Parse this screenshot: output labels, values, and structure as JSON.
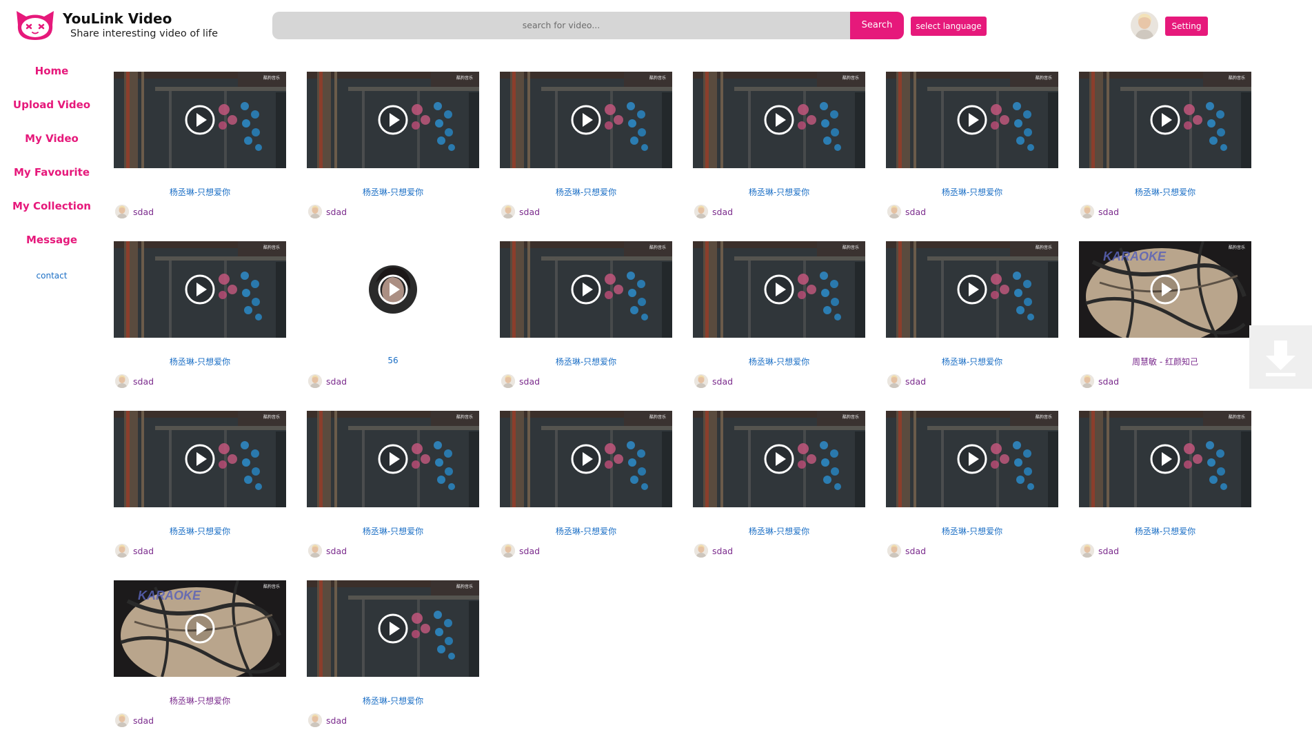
{
  "header": {
    "brand_title": "YouLink Video",
    "brand_subtitle": "Share interesting video of life",
    "search_placeholder": "search for video...",
    "search_label": "Search",
    "language_label": "select language",
    "setting_label": "Setting"
  },
  "sidebar": {
    "items": [
      {
        "label": "Home"
      },
      {
        "label": "Upload Video"
      },
      {
        "label": "My Video"
      },
      {
        "label": "My Favourite"
      },
      {
        "label": "My Collection"
      },
      {
        "label": "Message"
      }
    ],
    "contact": "contact"
  },
  "badge_text": "酷狗音乐",
  "colors": {
    "accent": "#e6197b",
    "link": "#1a6ec5",
    "visited": "#7a2a8c"
  },
  "videos": [
    {
      "title": "杨丞琳-只想爱你",
      "author": "sdad",
      "thumb": "room",
      "visited": false
    },
    {
      "title": "杨丞琳-只想爱你",
      "author": "sdad",
      "thumb": "room",
      "visited": false
    },
    {
      "title": "杨丞琳-只想爱你",
      "author": "sdad",
      "thumb": "room",
      "visited": false
    },
    {
      "title": "杨丞琳-只想爱你",
      "author": "sdad",
      "thumb": "room",
      "visited": false
    },
    {
      "title": "杨丞琳-只想爱你",
      "author": "sdad",
      "thumb": "room",
      "visited": false
    },
    {
      "title": "杨丞琳-只想爱你",
      "author": "sdad",
      "thumb": "room",
      "visited": false
    },
    {
      "title": "杨丞琳-只想爱你",
      "author": "sdad",
      "thumb": "room",
      "visited": false
    },
    {
      "title": "56",
      "author": "sdad",
      "thumb": "portrait",
      "visited": false
    },
    {
      "title": "杨丞琳-只想爱你",
      "author": "sdad",
      "thumb": "room",
      "visited": false
    },
    {
      "title": "杨丞琳-只想爱你",
      "author": "sdad",
      "thumb": "room",
      "visited": false
    },
    {
      "title": "杨丞琳-只想爱你",
      "author": "sdad",
      "thumb": "room",
      "visited": false
    },
    {
      "title": "周慧敏 - 红颜知己",
      "author": "sdad",
      "thumb": "karaoke",
      "visited": true
    },
    {
      "title": "杨丞琳-只想爱你",
      "author": "sdad",
      "thumb": "room",
      "visited": false
    },
    {
      "title": "杨丞琳-只想爱你",
      "author": "sdad",
      "thumb": "room",
      "visited": false
    },
    {
      "title": "杨丞琳-只想爱你",
      "author": "sdad",
      "thumb": "room",
      "visited": false
    },
    {
      "title": "杨丞琳-只想爱你",
      "author": "sdad",
      "thumb": "room",
      "visited": false
    },
    {
      "title": "杨丞琳-只想爱你",
      "author": "sdad",
      "thumb": "room",
      "visited": false
    },
    {
      "title": "杨丞琳-只想爱你",
      "author": "sdad",
      "thumb": "room",
      "visited": false
    },
    {
      "title": "杨丞琳-只想爱你",
      "author": "sdad",
      "thumb": "karaoke",
      "visited": true
    },
    {
      "title": "杨丞琳-只想爱你",
      "author": "sdad",
      "thumb": "room",
      "visited": false
    }
  ]
}
